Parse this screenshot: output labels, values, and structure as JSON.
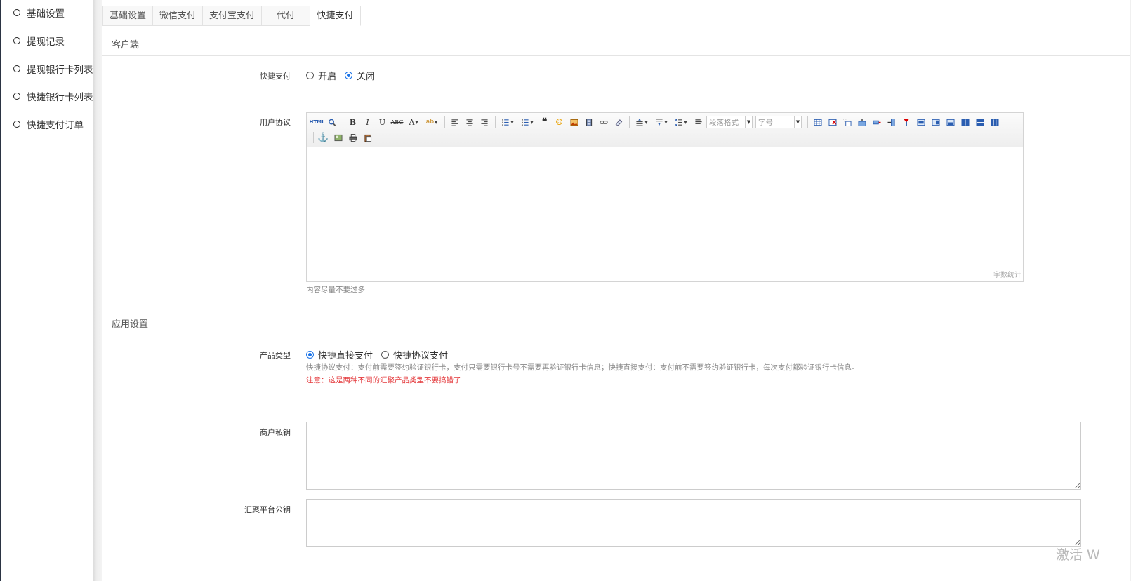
{
  "sidebar": {
    "items": [
      {
        "label": "基础设置"
      },
      {
        "label": "提现记录"
      },
      {
        "label": "提现银行卡列表"
      },
      {
        "label": "快捷银行卡列表"
      },
      {
        "label": "快捷支付订单"
      }
    ]
  },
  "tabs": [
    {
      "label": "基础设置"
    },
    {
      "label": "微信支付"
    },
    {
      "label": "支付宝支付"
    },
    {
      "label": "代付"
    },
    {
      "label": "快捷支付",
      "active": true
    }
  ],
  "section_client": {
    "title": "客户端",
    "quick_pay": {
      "label": "快捷支付",
      "options": [
        "开启",
        "关闭"
      ],
      "selected": "关闭"
    },
    "user_agreement": {
      "label": "用户协议",
      "toolbar": {
        "paragraph_placeholder": "段落格式",
        "fontsize_placeholder": "字号"
      },
      "word_count": "字数统计",
      "hint": "内容尽量不要过多"
    }
  },
  "section_app": {
    "title": "应用设置",
    "product_type": {
      "label": "产品类型",
      "options": [
        "快捷直接支付",
        "快捷协议支付"
      ],
      "selected": "快捷直接支付",
      "description": "快捷协议支付：支付前需要签约验证银行卡，支付只需要银行卡号不需要再验证银行卡信息；快捷直接支付：支付前不需要签约验证银行卡，每次支付都验证银行卡信息。",
      "warning": "注意：这是两种不同的汇聚产品类型不要搞错了"
    },
    "merchant_private_key": {
      "label": "商户私钥",
      "value": ""
    },
    "platform_public_key": {
      "label": "汇聚平台公钥",
      "value": ""
    }
  },
  "watermark": "激活 W",
  "colors": {
    "accent": "#1a73e8",
    "warning": "#e4393c",
    "sidebar_edge": "#2b3443"
  }
}
